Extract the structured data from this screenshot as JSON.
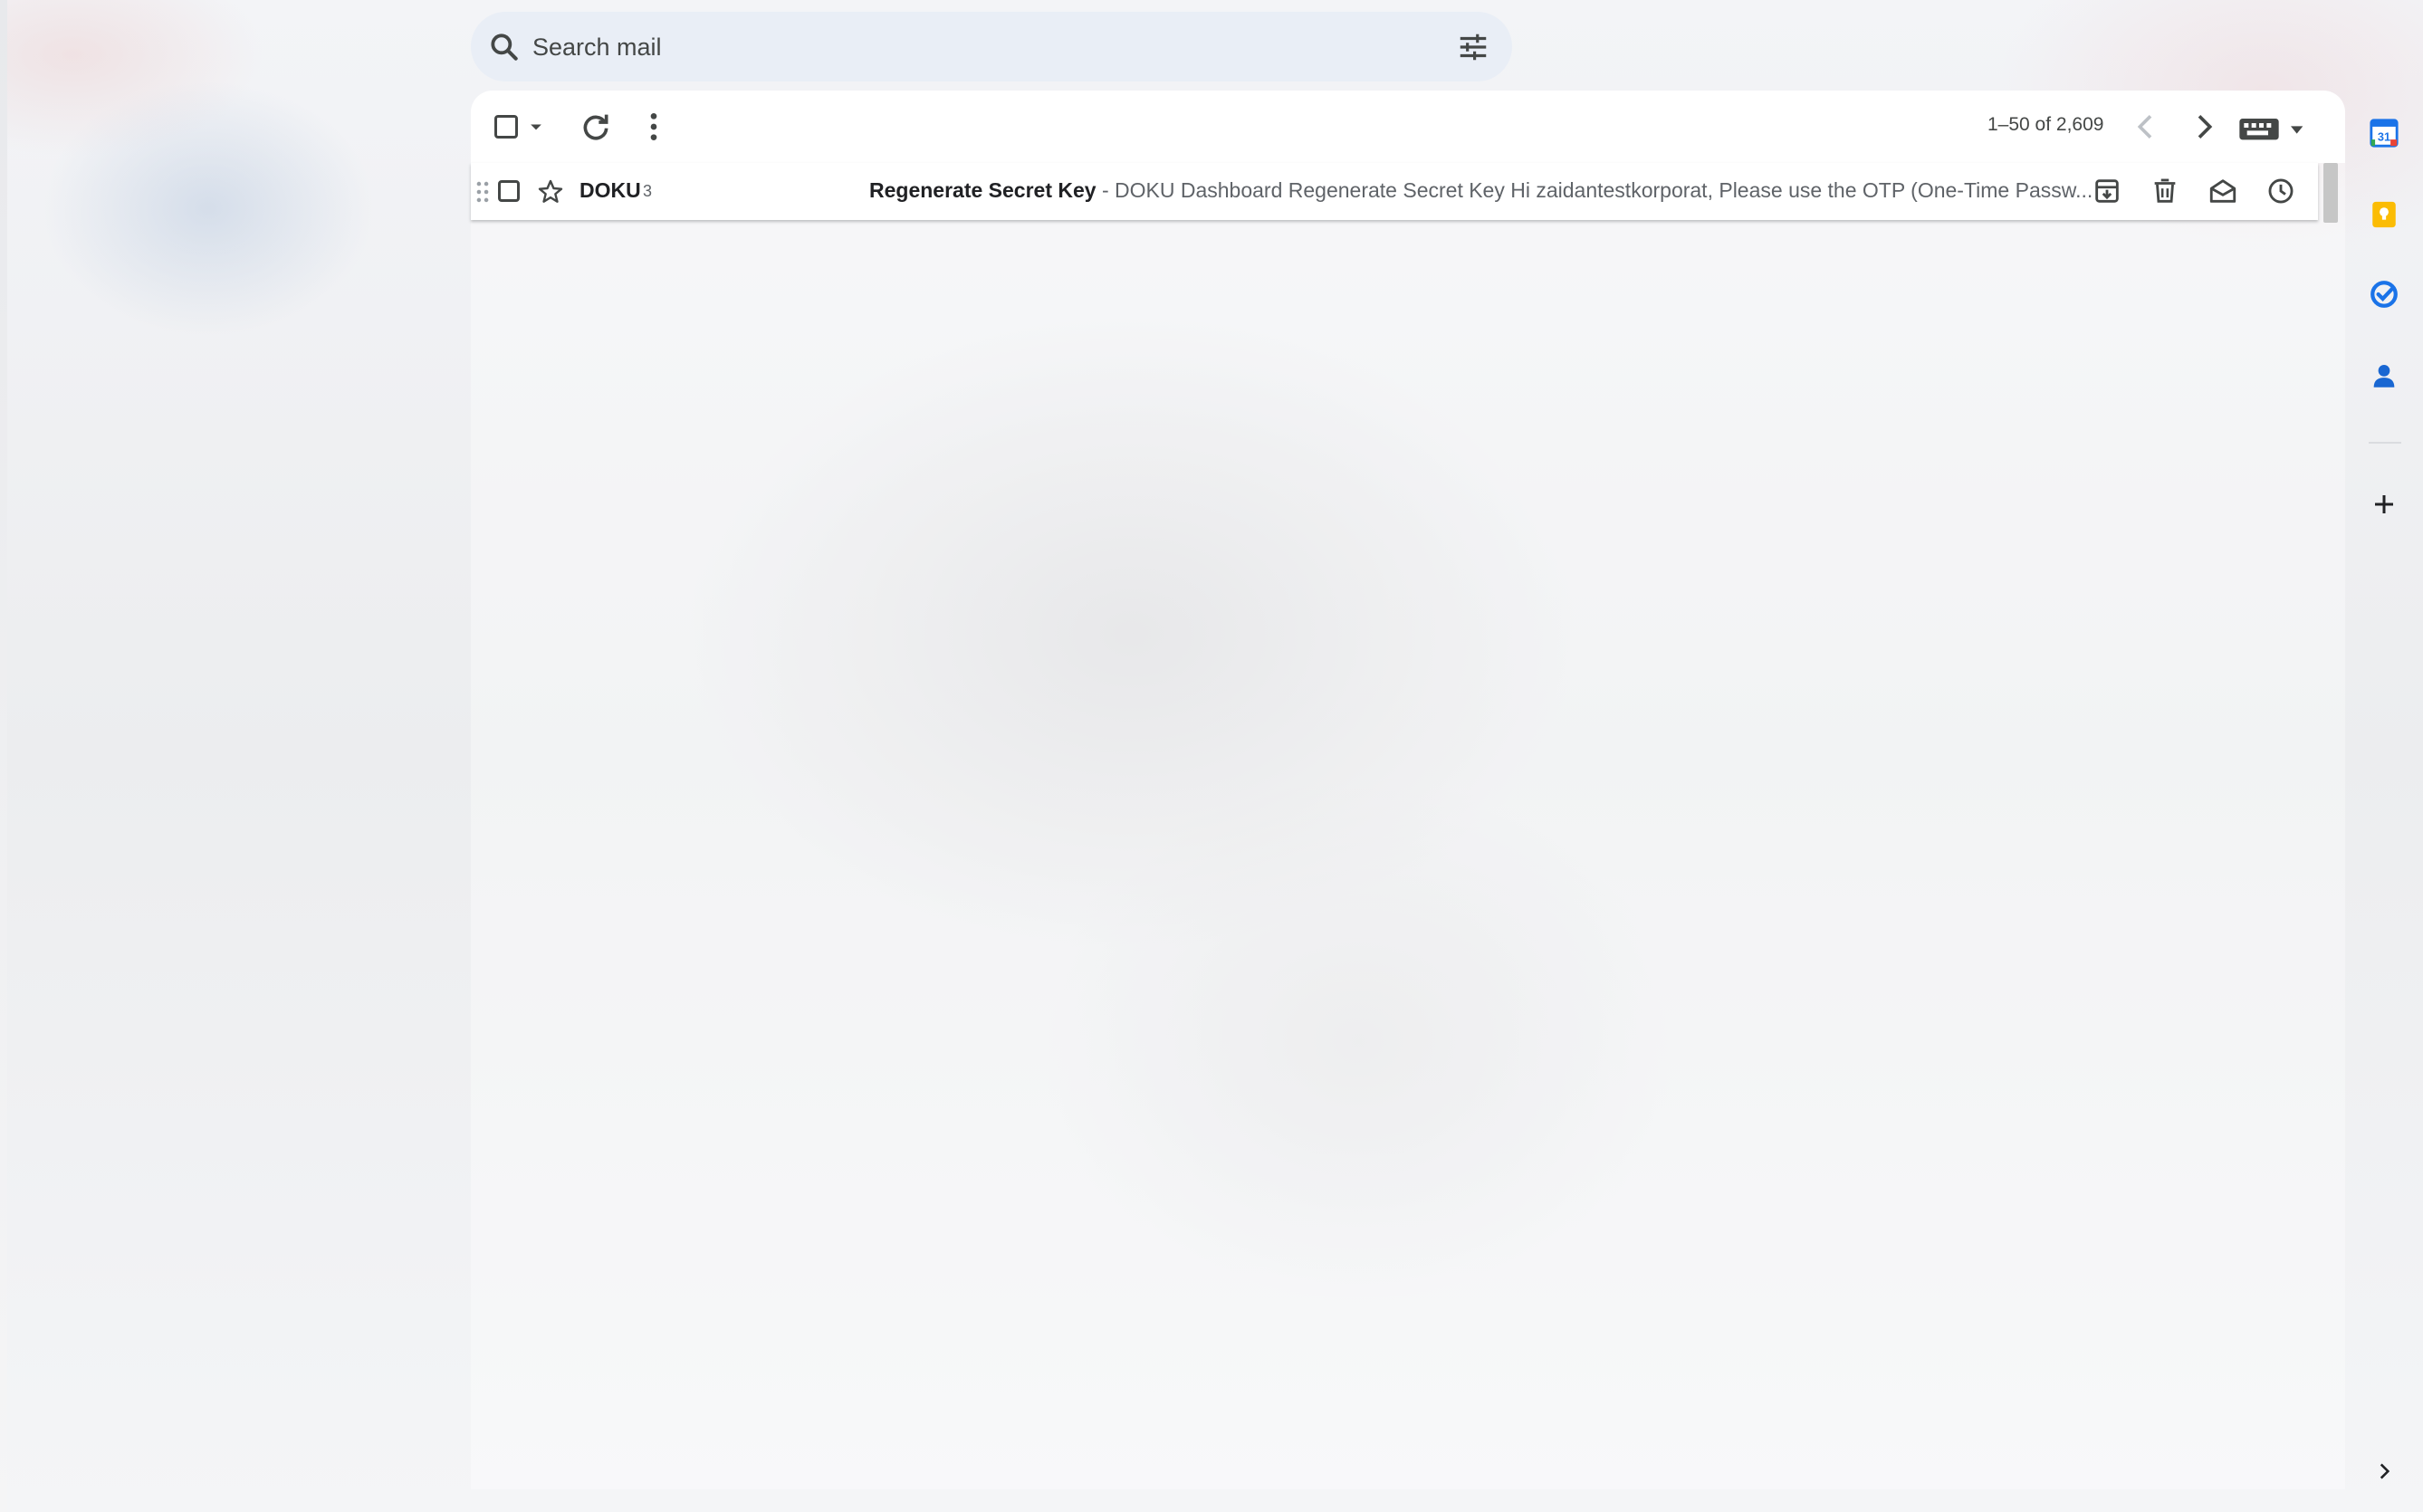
{
  "search": {
    "placeholder": "Search mail"
  },
  "toolbar": {
    "pagination": "1–50 of 2,609"
  },
  "emails": [
    {
      "sender": "DOKU",
      "count": "3",
      "subject": "Regenerate Secret Key",
      "snippet": " - DOKU Dashboard Regenerate Secret Key Hi zaidantestkorporat, Please use the OTP (One-Time Passw..."
    }
  ],
  "side_panel": {
    "calendar_day": "31"
  },
  "colors": {
    "accent_blue": "#1a73e8",
    "keep_yellow": "#fbbc04",
    "contacts_blue": "#1967d2",
    "search_bg": "#e9eef6"
  },
  "icons": [
    "search-icon",
    "tune-icon",
    "caret-down-icon",
    "refresh-icon",
    "more-vert-icon",
    "chevron-left-icon",
    "chevron-right-icon",
    "keyboard-icon",
    "drag-icon",
    "star-icon",
    "archive-icon",
    "delete-icon",
    "mark-read-icon",
    "snooze-icon",
    "calendar-icon",
    "keep-icon",
    "tasks-icon",
    "contacts-icon",
    "add-icon"
  ]
}
